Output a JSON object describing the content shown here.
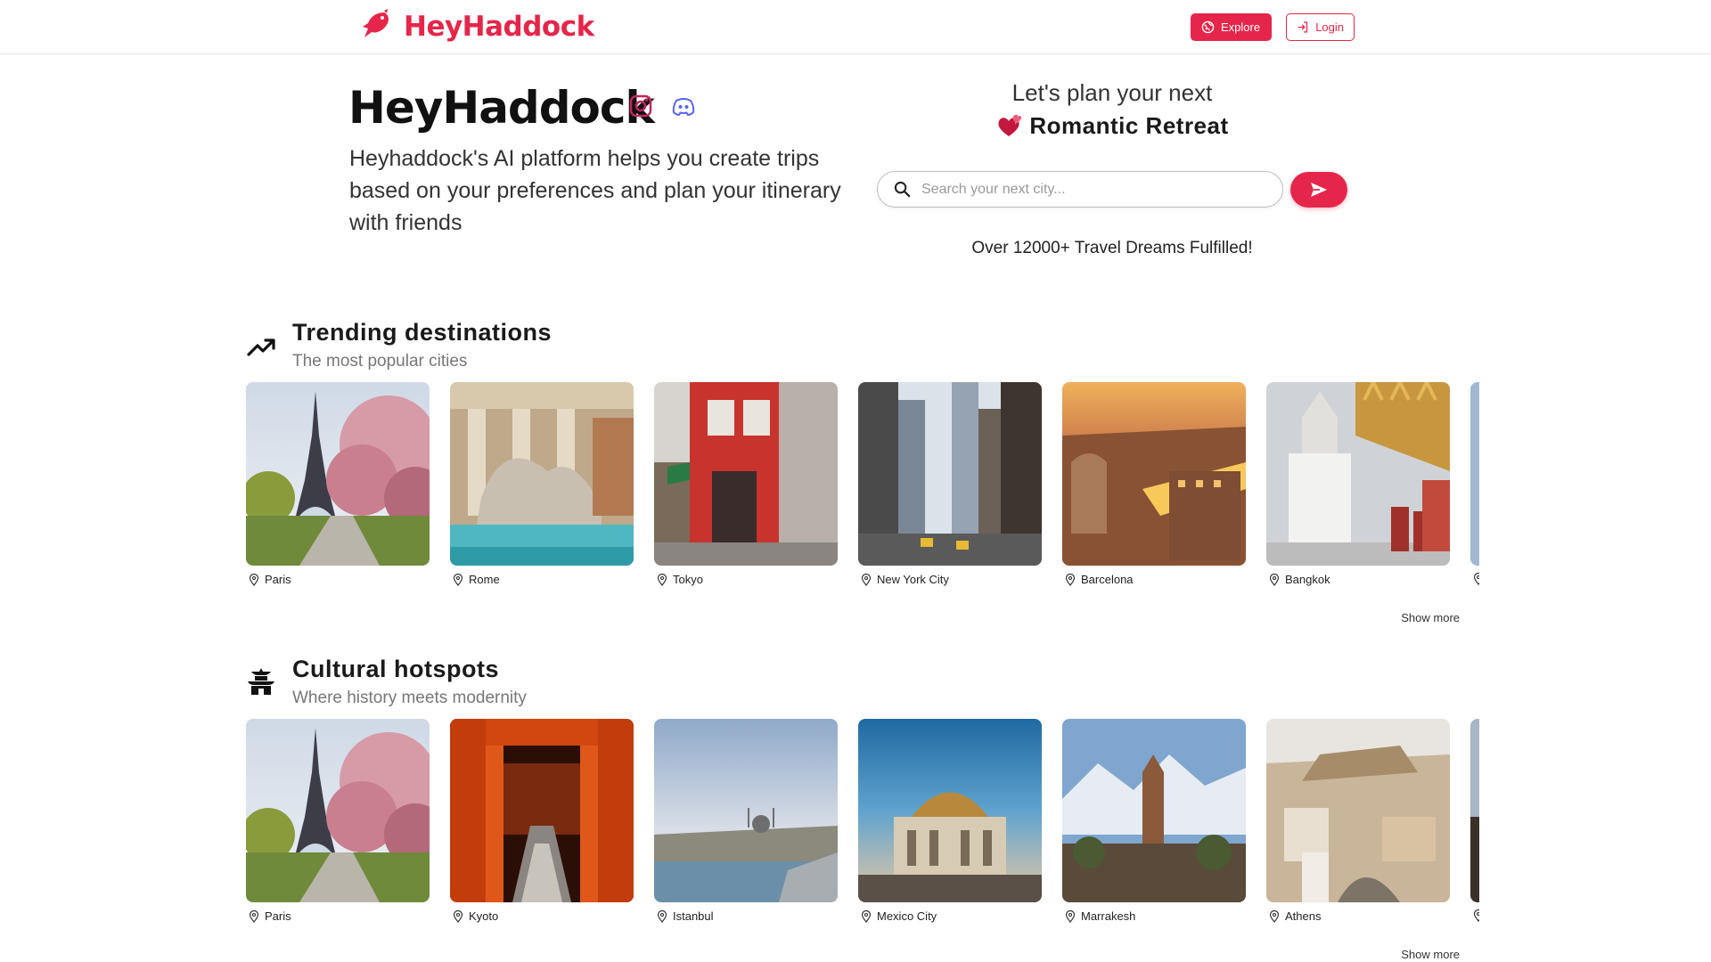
{
  "brand": {
    "name": "HeyHaddock",
    "color": "#e5264a"
  },
  "nav": {
    "explore_label": "Explore",
    "login_label": "Login"
  },
  "hero": {
    "title": "HeyHaddock",
    "description": "Heyhaddock's AI platform helps you create trips based on your preferences and plan your itinerary with friends",
    "plan_prefix": "Let's plan your next",
    "plan_highlight": "Romantic Retreat",
    "search_placeholder": "Search your next city...",
    "fulfilled_text": "Over 12000+ Travel Dreams Fulfilled!"
  },
  "sections": [
    {
      "icon": "trending-up-icon",
      "title": "Trending destinations",
      "subtitle": "The most popular cities",
      "cities": [
        "Paris",
        "Rome",
        "Tokyo",
        "New York City",
        "Barcelona",
        "Bangkok",
        ""
      ],
      "show_more": "Show more"
    },
    {
      "icon": "pagoda-icon",
      "title": "Cultural hotspots",
      "subtitle": "Where history meets modernity",
      "cities": [
        "Paris",
        "Kyoto",
        "Istanbul",
        "Mexico City",
        "Marrakesh",
        "Athens",
        ""
      ],
      "show_more": "Show more"
    }
  ]
}
